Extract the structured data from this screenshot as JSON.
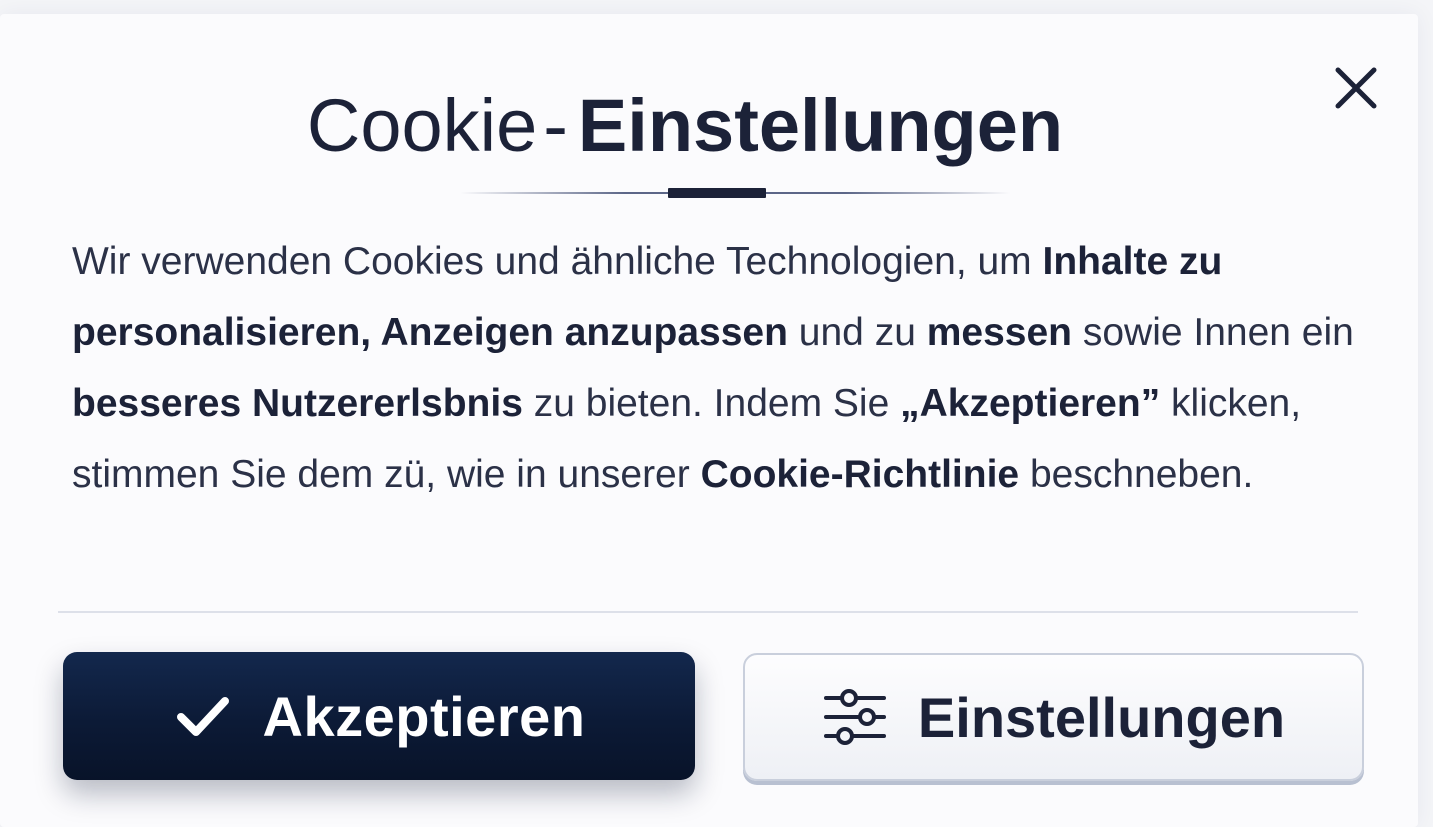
{
  "dialog": {
    "title_light": "Cookie",
    "title_separator": "-",
    "title_bold": "Einstellungen",
    "close_icon": "close-icon",
    "body": {
      "s1": "Wir verwenden Cookies und ähnliche Technologien,  um ",
      "b1": "Inhalte zu personalisieren, Anzeigen anzupassen",
      "s2": " und zu ",
      "b2": "messen",
      "s3": " sowie Innen ein ",
      "b3": "besseres Nutzererlsbnis",
      "s4": " zu bieten. Indem Sie ",
      "b4": "„Akzeptieren”",
      "s5": " klicken, stimmen Sie dem zü, wie in unserer ",
      "b5": "Cookie-Richtlinie",
      "s6": " beschneben."
    },
    "buttons": {
      "accept_label": "Akzeptieren",
      "accept_icon": "check-icon",
      "settings_label": "Einstellungen",
      "settings_icon": "sliders-icon"
    }
  },
  "colors": {
    "primary": "#0c1a36",
    "text": "#1c2238",
    "secondary_border": "#c9cfdc"
  }
}
